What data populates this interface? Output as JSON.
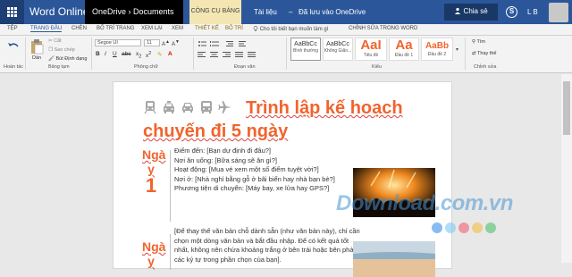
{
  "titlebar": {
    "app_name": "Word Online",
    "path": "OneDrive › Documents",
    "context_tab": "CÔNG CỤ BẢNG",
    "doc_title": "Tài liệu",
    "sep": "–",
    "saved_status": "Đã lưu vào OneDrive",
    "share_label": "Chia sẻ",
    "user_initials": "L B"
  },
  "tabs": [
    "TỆP",
    "TRANG ĐẦU",
    "CHÈN",
    "BỐ TRÍ TRANG",
    "XEM LẠI",
    "XEM",
    "THIẾT KẾ",
    "BỐ TRÍ",
    "Cho tôi biết bạn muốn làm gì",
    "CHỈNH SỬA TRONG WORD"
  ],
  "ribbon": {
    "undo_label": "Hoàn tác",
    "paste_label": "Dán",
    "cut_label": "Cắt",
    "copy_label": "Sao chép",
    "format_painter_label": "Bút Định dạng",
    "clipboard_group": "Bảng tạm",
    "font_name": "Segoe UI",
    "font_size": "11",
    "font_group": "Phông chữ",
    "paragraph_group": "Đoạn văn",
    "styles_group": "Kiểu",
    "find_label": "Tìm",
    "replace_label": "Thay thế",
    "editing_group": "Chỉnh sửa",
    "styles": [
      {
        "preview": "AaBbCc",
        "name": "Bình thường"
      },
      {
        "preview": "AaBbCc",
        "name": "Không Giãn..."
      },
      {
        "preview": "AaI",
        "name": "Tiêu đề"
      },
      {
        "preview": "Aa",
        "name": "Đầu đề 1"
      },
      {
        "preview": "AaBb",
        "name": "Đầu đề 2"
      }
    ]
  },
  "document": {
    "title_line1": "Trình lập kế hoạch",
    "title_line2": "chuyến đi 5 ngày",
    "day_label": "Ngà\ny",
    "day1_num": "1",
    "day1_lines": [
      "Điểm đến: [Bạn dự định đi đâu?]",
      "Nơi ăn uống: [Bữa sáng sẽ ăn gì?]",
      "Hoạt động: [Mua vé xem một số điểm tuyệt vời?]",
      "Nơi ở: [Nhà nghỉ bằng gỗ ở bãi biển hay nhà bạn bè?]",
      "Phương tiện di chuyển: [Máy bay, xe lửa hay GPS?]"
    ],
    "day2_label": "Ngà\ny",
    "day2_lines": [
      "[Để thay thế văn bản chỗ dành sẵn (như văn bản này), chỉ cần",
      "chọn một dòng văn bản và bắt đầu nhập. Để có kết quả tốt",
      "nhất, không nên chừa khoảng trắng ở bên trái hoặc bên phải",
      "các ký tự trong phần chọn của bạn]."
    ]
  },
  "watermark": "Download.com.vn",
  "colors": {
    "brand_blue": "#2b579a",
    "heading_orange": "#f0642d"
  }
}
